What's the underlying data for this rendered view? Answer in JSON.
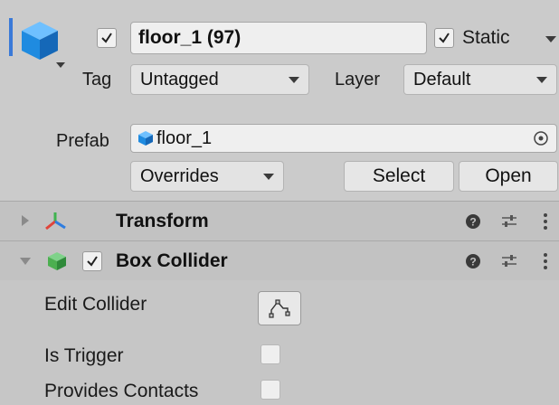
{
  "header": {
    "active_checked": true,
    "name": "floor_1 (97)",
    "static_label": "Static",
    "static_checked": true,
    "tag_label": "Tag",
    "tag_value": "Untagged",
    "layer_label": "Layer",
    "layer_value": "Default",
    "prefab_label": "Prefab",
    "prefab_value": "floor_1",
    "overrides_label": "Overrides",
    "select_label": "Select",
    "open_label": "Open"
  },
  "components": [
    {
      "title": "Transform",
      "expanded": false,
      "has_checkbox": false
    },
    {
      "title": "Box Collider",
      "expanded": true,
      "has_checkbox": true,
      "enabled": true
    }
  ],
  "box_collider": {
    "edit_collider_label": "Edit Collider",
    "is_trigger_label": "Is Trigger",
    "is_trigger": false,
    "provides_contacts_label": "Provides Contacts",
    "provides_contacts": false
  },
  "colors": {
    "selection_accent": "#3a79d8",
    "cube_blue": "#1f8be0",
    "collider_green": "#4caf50"
  },
  "icons": [
    "gameobject-cube-icon",
    "check-icon",
    "prefab-cube-icon",
    "target-icon",
    "transform-axes-icon",
    "box-collider-icon",
    "help-icon",
    "preset-sliders-icon",
    "kebab-menu-icon",
    "edit-collider-icon"
  ]
}
